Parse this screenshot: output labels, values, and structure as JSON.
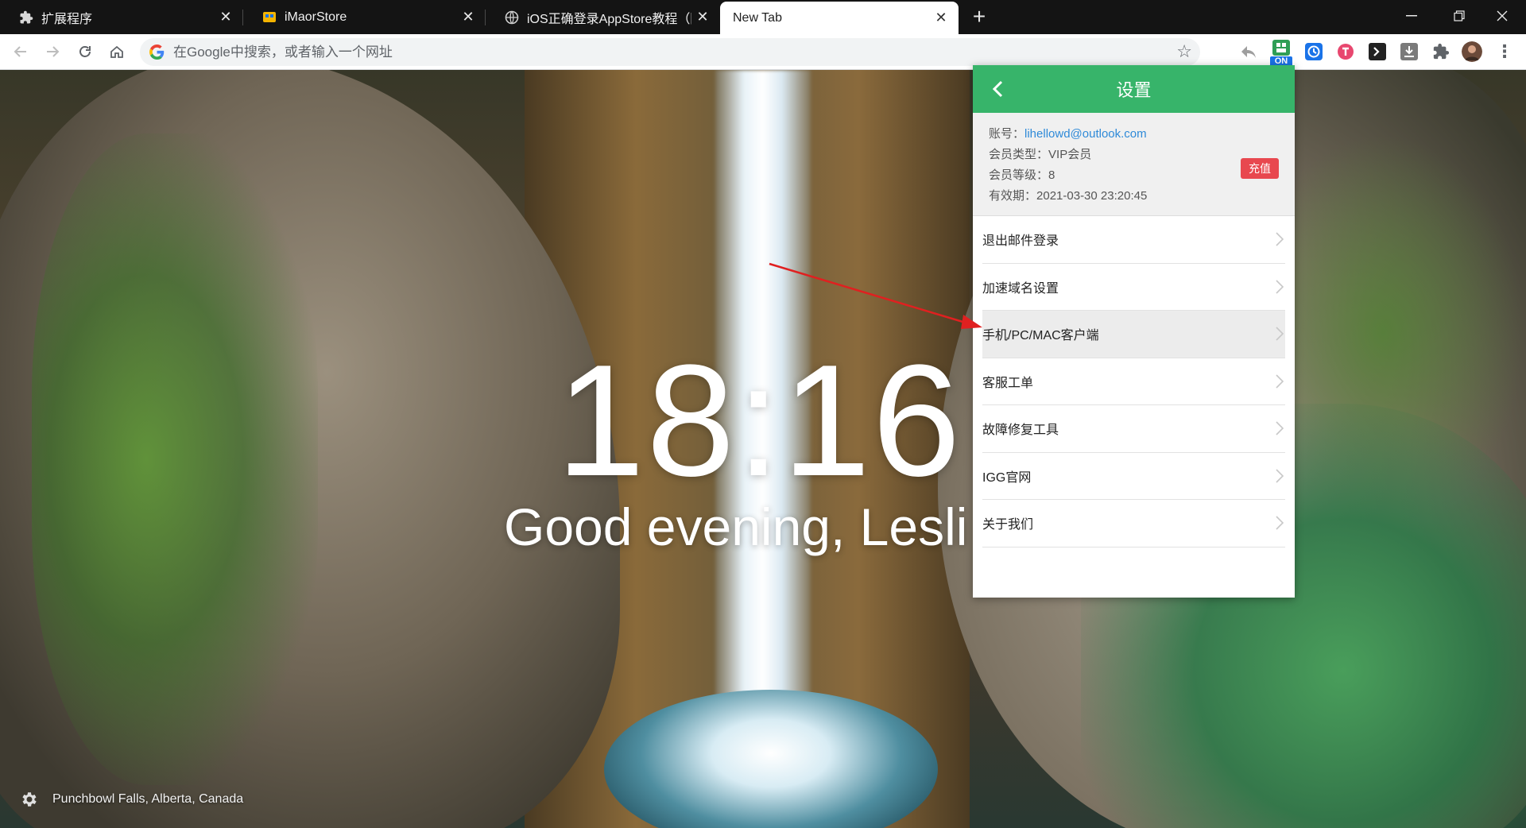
{
  "browser": {
    "tabs": [
      {
        "title": "扩展程序",
        "active": false
      },
      {
        "title": "iMaorStore",
        "active": false
      },
      {
        "title": "iOS正确登录AppStore教程（防",
        "active": false
      },
      {
        "title": "New Tab",
        "active": true
      }
    ],
    "new_tab_label": "+",
    "omnibox": {
      "placeholder": "在Google中搜索，或者输入一个网址",
      "value": ""
    },
    "extension_badge": "ON"
  },
  "newtab": {
    "time": "18:16",
    "greeting": "Good evening, Lesli",
    "photo_credit": "Punchbowl Falls, Alberta, Canada"
  },
  "popup": {
    "title": "设置",
    "account": {
      "email_label": "账号：",
      "email": "lihellowd@outlook.com",
      "member_type_label": "会员类型：",
      "member_type": "VIP会员",
      "member_level_label": "会员等级：",
      "member_level": "8",
      "expiry_label": "有效期：",
      "expiry": "2021-03-30 23:20:45",
      "recharge_label": "充值"
    },
    "menu": [
      {
        "label": "退出邮件登录"
      },
      {
        "label": "加速域名设置"
      },
      {
        "label": "手机/PC/MAC客户端"
      },
      {
        "label": "客服工单"
      },
      {
        "label": "故障修复工具"
      },
      {
        "label": "IGG官网"
      },
      {
        "label": "关于我们"
      }
    ]
  },
  "colors": {
    "popup_header": "#37b46a",
    "recharge": "#e8484f",
    "link": "#2f8ad8",
    "annotation_arrow": "#e02020"
  }
}
